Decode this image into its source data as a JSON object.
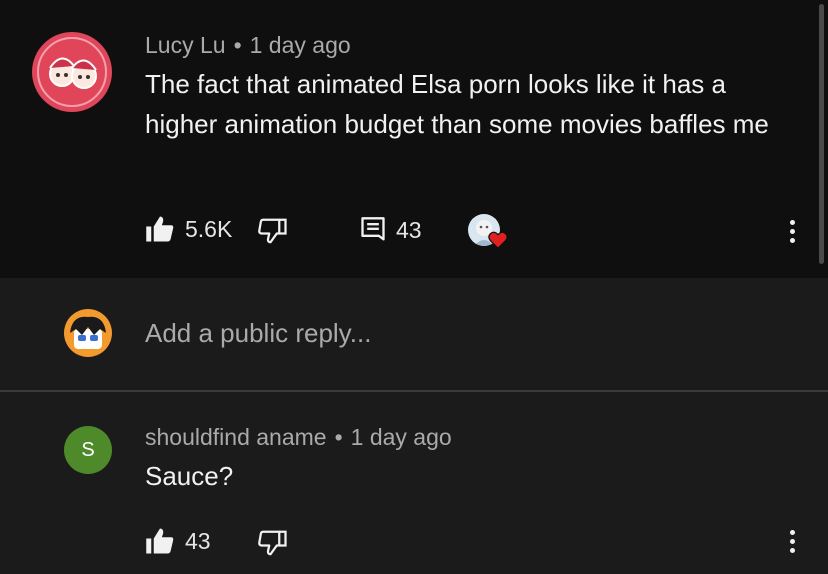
{
  "main_comment": {
    "author": "Lucy Lu",
    "separator": "•",
    "time": "1 day ago",
    "text": "The fact that animated Elsa porn looks like it has a higher animation budget than some movies baffles me",
    "likes": "5.6K",
    "replies": "43",
    "icons": {
      "like": "thumbs-up-icon",
      "dislike": "thumbs-down-icon",
      "reply": "comment-icon",
      "heart": "creator-heart-icon",
      "more": "more-vert-icon"
    }
  },
  "reply_input": {
    "placeholder": "Add a public reply..."
  },
  "reply_comment": {
    "avatar_letter": "S",
    "author": "shouldfind aname",
    "separator": "•",
    "time": "1 day ago",
    "text": "Sauce?",
    "likes": "43"
  },
  "colors": {
    "background": "#0f0f0f",
    "reply_background": "#1b1b1b",
    "lucy_avatar": "#e0455a",
    "s_avatar": "#4f8a2a",
    "heart": "#e02020"
  }
}
